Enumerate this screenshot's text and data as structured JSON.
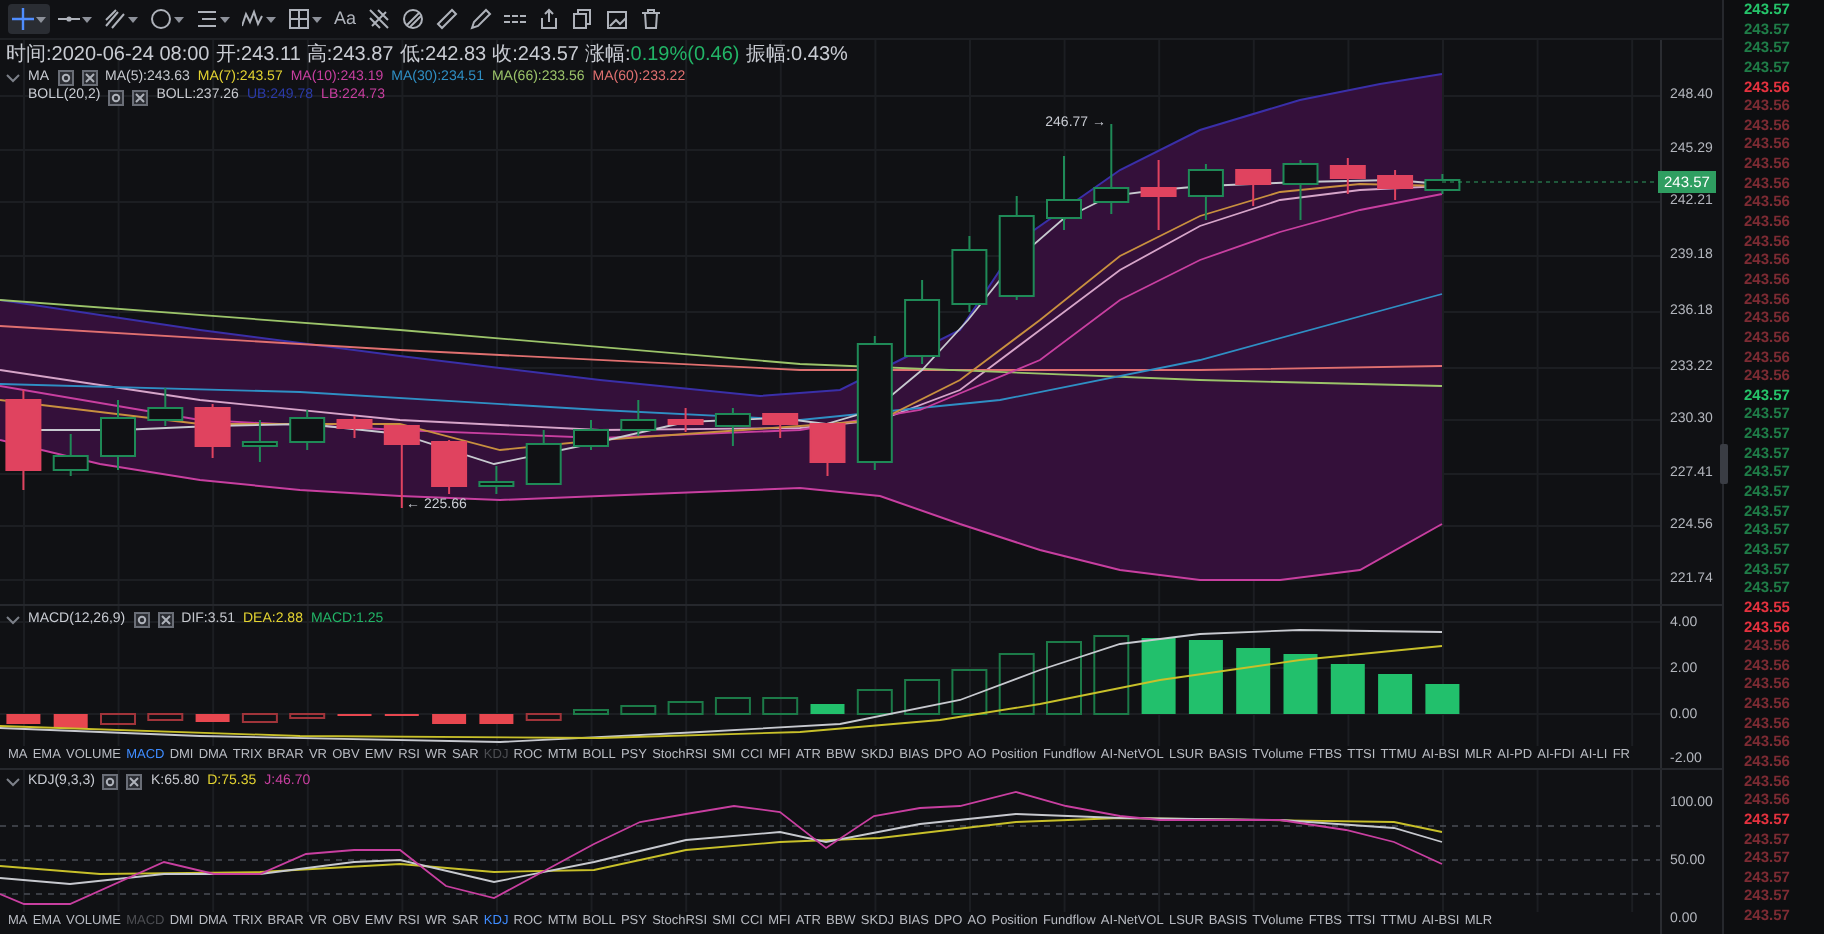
{
  "toolbar": {
    "tools": [
      {
        "kind": "crosshair",
        "selected": true,
        "dropdown": true
      },
      {
        "kind": "horizontal-line",
        "selected": false,
        "dropdown": true
      },
      {
        "kind": "parallel-lines",
        "selected": false,
        "dropdown": true
      },
      {
        "kind": "circle",
        "selected": false,
        "dropdown": true
      },
      {
        "kind": "levels",
        "selected": false,
        "dropdown": true
      },
      {
        "kind": "wave",
        "selected": false,
        "dropdown": true
      },
      {
        "kind": "grid",
        "selected": false,
        "dropdown": true
      },
      {
        "kind": "text",
        "label": "Aa",
        "selected": false,
        "dropdown": false
      },
      {
        "kind": "pattern",
        "selected": false,
        "dropdown": false
      },
      {
        "kind": "stripes",
        "selected": false,
        "dropdown": false
      },
      {
        "kind": "ruler",
        "selected": false,
        "dropdown": false
      },
      {
        "kind": "pencil",
        "selected": false,
        "dropdown": false
      },
      {
        "kind": "dashes",
        "selected": false,
        "dropdown": false
      },
      {
        "kind": "share",
        "selected": false,
        "dropdown": false
      },
      {
        "kind": "copy",
        "selected": false,
        "dropdown": false
      },
      {
        "kind": "picture",
        "selected": false,
        "dropdown": false
      },
      {
        "kind": "trash",
        "selected": false,
        "dropdown": false
      }
    ]
  },
  "ohlc": [
    {
      "label": "时间:",
      "value": "2020-06-24 08:00",
      "color": "#c9ccd3"
    },
    {
      "label": "开:",
      "value": "243.11",
      "color": "#c9ccd3"
    },
    {
      "label": "高:",
      "value": "243.87",
      "color": "#c9ccd3"
    },
    {
      "label": "低:",
      "value": "242.83",
      "color": "#c9ccd3"
    },
    {
      "label": "收:",
      "value": "243.57",
      "color": "#c9ccd3"
    },
    {
      "label": "涨幅:",
      "value": "0.19%(0.46)",
      "color": "#22b567"
    },
    {
      "label": "振幅:",
      "value": "0.43%",
      "color": "#c9ccd3"
    }
  ],
  "main_indicators": [
    {
      "name": "MA",
      "collapse_toggle": true,
      "values": [
        {
          "text": "MA(5):243.63",
          "color": "#c7c9cf"
        },
        {
          "text": "MA(7):243.57",
          "color": "#e3d331"
        },
        {
          "text": "MA(10):243.19",
          "color": "#c83fa0"
        },
        {
          "text": "MA(30):234.51",
          "color": "#2f8fc4"
        },
        {
          "text": "MA(66):233.56",
          "color": "#9cc46a"
        },
        {
          "text": "MA(60):233.22",
          "color": "#e07070"
        }
      ]
    },
    {
      "name": "BOLL(20,2)",
      "collapse_toggle": false,
      "values": [
        {
          "text": "BOLL:237.26",
          "color": "#c7c9cf"
        },
        {
          "text": "UB:249.78",
          "color": "#2b3aa8"
        },
        {
          "text": "LB:224.73",
          "color": "#c83fa0"
        }
      ]
    }
  ],
  "main_axis": [
    "248.40",
    "245.29",
    "242.21",
    "239.18",
    "236.18",
    "233.22",
    "230.30",
    "227.41",
    "224.56",
    "221.74"
  ],
  "current_price": "243.57",
  "high_label": "246.77 →",
  "low_label": "← 225.66",
  "macd_legend": {
    "name": "MACD(12,26,9)",
    "collapse_toggle": true,
    "values": [
      {
        "text": "DIF:3.51",
        "color": "#c7c9cf"
      },
      {
        "text": "DEA:2.88",
        "color": "#e3d331"
      },
      {
        "text": "MACD:1.25",
        "color": "#22b567"
      }
    ]
  },
  "macd_axis": [
    "4.00",
    "2.00",
    "0.00",
    "-2.00"
  ],
  "indicator_tabs_1": [
    {
      "label": "MA",
      "selected": false,
      "disabled": false
    },
    {
      "label": "EMA",
      "selected": false,
      "disabled": false
    },
    {
      "label": "VOLUME",
      "selected": false,
      "disabled": false
    },
    {
      "label": "MACD",
      "selected": true,
      "disabled": false
    },
    {
      "label": "DMI",
      "selected": false,
      "disabled": false
    },
    {
      "label": "DMA",
      "selected": false,
      "disabled": false
    },
    {
      "label": "TRIX",
      "selected": false,
      "disabled": false
    },
    {
      "label": "BRAR",
      "selected": false,
      "disabled": false
    },
    {
      "label": "VR",
      "selected": false,
      "disabled": false
    },
    {
      "label": "OBV",
      "selected": false,
      "disabled": false
    },
    {
      "label": "EMV",
      "selected": false,
      "disabled": false
    },
    {
      "label": "RSI",
      "selected": false,
      "disabled": false
    },
    {
      "label": "WR",
      "selected": false,
      "disabled": false
    },
    {
      "label": "SAR",
      "selected": false,
      "disabled": false
    },
    {
      "label": "KDJ",
      "selected": false,
      "disabled": true
    },
    {
      "label": "ROC",
      "selected": false,
      "disabled": false
    },
    {
      "label": "MTM",
      "selected": false,
      "disabled": false
    },
    {
      "label": "BOLL",
      "selected": false,
      "disabled": false
    },
    {
      "label": "PSY",
      "selected": false,
      "disabled": false
    },
    {
      "label": "StochRSI",
      "selected": false,
      "disabled": false
    },
    {
      "label": "SMI",
      "selected": false,
      "disabled": false
    },
    {
      "label": "CCI",
      "selected": false,
      "disabled": false
    },
    {
      "label": "MFI",
      "selected": false,
      "disabled": false
    },
    {
      "label": "ATR",
      "selected": false,
      "disabled": false
    },
    {
      "label": "BBW",
      "selected": false,
      "disabled": false
    },
    {
      "label": "SKDJ",
      "selected": false,
      "disabled": false
    },
    {
      "label": "BIAS",
      "selected": false,
      "disabled": false
    },
    {
      "label": "DPO",
      "selected": false,
      "disabled": false
    },
    {
      "label": "AO",
      "selected": false,
      "disabled": false
    },
    {
      "label": "Position",
      "selected": false,
      "disabled": false
    },
    {
      "label": "Fundflow",
      "selected": false,
      "disabled": false
    },
    {
      "label": "AI-NetVOL",
      "selected": false,
      "disabled": false
    },
    {
      "label": "LSUR",
      "selected": false,
      "disabled": false
    },
    {
      "label": "BASIS",
      "selected": false,
      "disabled": false
    },
    {
      "label": "TVolume",
      "selected": false,
      "disabled": false
    },
    {
      "label": "FTBS",
      "selected": false,
      "disabled": false
    },
    {
      "label": "TTSI",
      "selected": false,
      "disabled": false
    },
    {
      "label": "TTMU",
      "selected": false,
      "disabled": false
    },
    {
      "label": "AI-BSI",
      "selected": false,
      "disabled": false
    },
    {
      "label": "MLR",
      "selected": false,
      "disabled": false
    },
    {
      "label": "AI-PD",
      "selected": false,
      "disabled": false
    },
    {
      "label": "AI-FDI",
      "selected": false,
      "disabled": false
    },
    {
      "label": "AI-LI",
      "selected": false,
      "disabled": false
    },
    {
      "label": "FR",
      "selected": false,
      "disabled": false
    }
  ],
  "kdj_legend": {
    "name": "KDJ(9,3,3)",
    "collapse_toggle": true,
    "values": [
      {
        "text": "K:65.80",
        "color": "#c7c9cf"
      },
      {
        "text": "D:75.35",
        "color": "#e3d331"
      },
      {
        "text": "J:46.70",
        "color": "#c83fa0"
      }
    ]
  },
  "kdj_axis": [
    "100.00",
    "50.00",
    "0.00"
  ],
  "indicator_tabs_2": [
    {
      "label": "MA",
      "selected": false,
      "disabled": false
    },
    {
      "label": "EMA",
      "selected": false,
      "disabled": false
    },
    {
      "label": "VOLUME",
      "selected": false,
      "disabled": false
    },
    {
      "label": "MACD",
      "selected": false,
      "disabled": true
    },
    {
      "label": "DMI",
      "selected": false,
      "disabled": false
    },
    {
      "label": "DMA",
      "selected": false,
      "disabled": false
    },
    {
      "label": "TRIX",
      "selected": false,
      "disabled": false
    },
    {
      "label": "BRAR",
      "selected": false,
      "disabled": false
    },
    {
      "label": "VR",
      "selected": false,
      "disabled": false
    },
    {
      "label": "OBV",
      "selected": false,
      "disabled": false
    },
    {
      "label": "EMV",
      "selected": false,
      "disabled": false
    },
    {
      "label": "RSI",
      "selected": false,
      "disabled": false
    },
    {
      "label": "WR",
      "selected": false,
      "disabled": false
    },
    {
      "label": "SAR",
      "selected": false,
      "disabled": false
    },
    {
      "label": "KDJ",
      "selected": true,
      "disabled": false
    },
    {
      "label": "ROC",
      "selected": false,
      "disabled": false
    },
    {
      "label": "MTM",
      "selected": false,
      "disabled": false
    },
    {
      "label": "BOLL",
      "selected": false,
      "disabled": false
    },
    {
      "label": "PSY",
      "selected": false,
      "disabled": false
    },
    {
      "label": "StochRSI",
      "selected": false,
      "disabled": false
    },
    {
      "label": "SMI",
      "selected": false,
      "disabled": false
    },
    {
      "label": "CCI",
      "selected": false,
      "disabled": false
    },
    {
      "label": "MFI",
      "selected": false,
      "disabled": false
    },
    {
      "label": "ATR",
      "selected": false,
      "disabled": false
    },
    {
      "label": "BBW",
      "selected": false,
      "disabled": false
    },
    {
      "label": "SKDJ",
      "selected": false,
      "disabled": false
    },
    {
      "label": "BIAS",
      "selected": false,
      "disabled": false
    },
    {
      "label": "DPO",
      "selected": false,
      "disabled": false
    },
    {
      "label": "AO",
      "selected": false,
      "disabled": false
    },
    {
      "label": "Position",
      "selected": false,
      "disabled": false
    },
    {
      "label": "Fundflow",
      "selected": false,
      "disabled": false
    },
    {
      "label": "AI-NetVOL",
      "selected": false,
      "disabled": false
    },
    {
      "label": "LSUR",
      "selected": false,
      "disabled": false
    },
    {
      "label": "BASIS",
      "selected": false,
      "disabled": false
    },
    {
      "label": "TVolume",
      "selected": false,
      "disabled": false
    },
    {
      "label": "FTBS",
      "selected": false,
      "disabled": false
    },
    {
      "label": "TTSI",
      "selected": false,
      "disabled": false
    },
    {
      "label": "TTMU",
      "selected": false,
      "disabled": false
    },
    {
      "label": "AI-BSI",
      "selected": false,
      "disabled": false
    },
    {
      "label": "MLR",
      "selected": false,
      "disabled": false
    }
  ],
  "price_list": [
    {
      "price": "243.57",
      "color": "#25c46a"
    },
    {
      "price": "243.57",
      "color": "#1f7d48"
    },
    {
      "price": "243.57",
      "color": "#1f7d48"
    },
    {
      "price": "243.57",
      "color": "#1f7d48"
    },
    {
      "price": "243.56",
      "color": "#e5323f"
    },
    {
      "price": "243.56",
      "color": "#7d2b33"
    },
    {
      "price": "243.56",
      "color": "#7d2b33"
    },
    {
      "price": "243.56",
      "color": "#7d2b33"
    },
    {
      "price": "243.56",
      "color": "#7d2b33"
    },
    {
      "price": "243.56",
      "color": "#7d2b33"
    },
    {
      "price": "243.56",
      "color": "#7d2b33"
    },
    {
      "price": "243.56",
      "color": "#7d2b33"
    },
    {
      "price": "243.56",
      "color": "#7d2b33"
    },
    {
      "price": "243.56",
      "color": "#7d2b33"
    },
    {
      "price": "243.56",
      "color": "#7d2b33"
    },
    {
      "price": "243.56",
      "color": "#7d2b33"
    },
    {
      "price": "243.56",
      "color": "#7d2b33"
    },
    {
      "price": "243.56",
      "color": "#7d2b33"
    },
    {
      "price": "243.56",
      "color": "#7d2b33"
    },
    {
      "price": "243.56",
      "color": "#7d2b33"
    },
    {
      "price": "243.57",
      "color": "#25c46a"
    },
    {
      "price": "243.57",
      "color": "#1f7d48"
    },
    {
      "price": "243.57",
      "color": "#1f7d48"
    },
    {
      "price": "243.57",
      "color": "#1f7d48"
    },
    {
      "price": "243.57",
      "color": "#1f7d48"
    },
    {
      "price": "243.57",
      "color": "#1f7d48"
    },
    {
      "price": "243.57",
      "color": "#1f7d48"
    },
    {
      "price": "243.57",
      "color": "#1f7d48"
    },
    {
      "price": "243.57",
      "color": "#1f7d48"
    },
    {
      "price": "243.57",
      "color": "#1f7d48"
    },
    {
      "price": "243.57",
      "color": "#1f7d48"
    },
    {
      "price": "243.55",
      "color": "#e5323f"
    },
    {
      "price": "243.56",
      "color": "#e5323f"
    },
    {
      "price": "243.56",
      "color": "#7d2b33"
    },
    {
      "price": "243.56",
      "color": "#7d2b33"
    },
    {
      "price": "243.56",
      "color": "#7d2b33"
    },
    {
      "price": "243.56",
      "color": "#7d2b33"
    },
    {
      "price": "243.56",
      "color": "#7d2b33"
    },
    {
      "price": "243.56",
      "color": "#7d2b33"
    },
    {
      "price": "243.56",
      "color": "#7d2b33"
    },
    {
      "price": "243.56",
      "color": "#7d2b33"
    },
    {
      "price": "243.56",
      "color": "#7d2b33"
    },
    {
      "price": "243.57",
      "color": "#e5323f"
    },
    {
      "price": "243.57",
      "color": "#7d2b33"
    },
    {
      "price": "243.57",
      "color": "#7d2b33"
    },
    {
      "price": "243.57",
      "color": "#7d2b33"
    },
    {
      "price": "243.57",
      "color": "#7d2b33"
    },
    {
      "price": "243.57",
      "color": "#7d2b33"
    }
  ]
}
